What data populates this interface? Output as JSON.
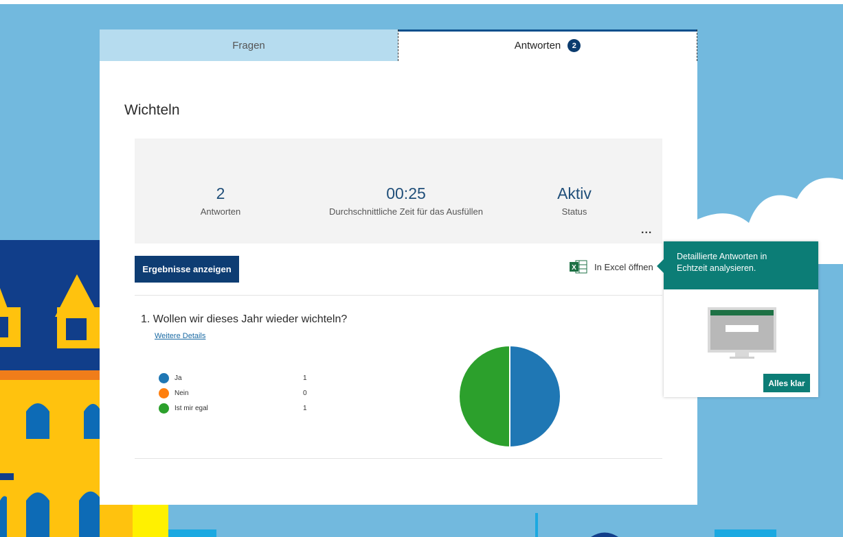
{
  "tabs": [
    {
      "label": "Fragen"
    },
    {
      "label": "Antworten",
      "badge": "2"
    }
  ],
  "form": {
    "title": "Wichteln"
  },
  "stats": [
    {
      "value": "2",
      "label": "Antworten"
    },
    {
      "value": "00:25",
      "label": "Durchschnittliche Zeit für das Ausfüllen"
    },
    {
      "value": "Aktiv",
      "label": "Status"
    }
  ],
  "more_label": "...",
  "actions": {
    "results_button": "Ergebnisse anzeigen",
    "excel_label": "In Excel öffnen",
    "excel_icon": "excel-icon"
  },
  "question": {
    "text": "1. Wollen wir dieses Jahr wieder wichteln?",
    "details_link": "Weitere Details",
    "options": [
      {
        "label": "Ja",
        "count": "1",
        "color": "#1f77b4"
      },
      {
        "label": "Nein",
        "count": "0",
        "color": "#ff7f0e"
      },
      {
        "label": "Ist mir egal",
        "count": "1",
        "color": "#2ca02c"
      }
    ]
  },
  "chart_data": {
    "type": "pie",
    "categories": [
      "Ja",
      "Nein",
      "Ist mir egal"
    ],
    "values": [
      1,
      0,
      1
    ],
    "colors": [
      "#1f77b4",
      "#ff7f0e",
      "#2ca02c"
    ]
  },
  "callout": {
    "text_line1": "Detaillierte Antworten in",
    "text_line2": "Echtzeit analysieren.",
    "button": "Alles klar",
    "illustration": "monitor-illustration"
  },
  "colors": {
    "background": "#72b9de",
    "tab_inactive": "#b6dcef",
    "primary_button": "#0e3d73",
    "accent_teal": "#0c7d76",
    "stat_value": "#1f4e79"
  }
}
